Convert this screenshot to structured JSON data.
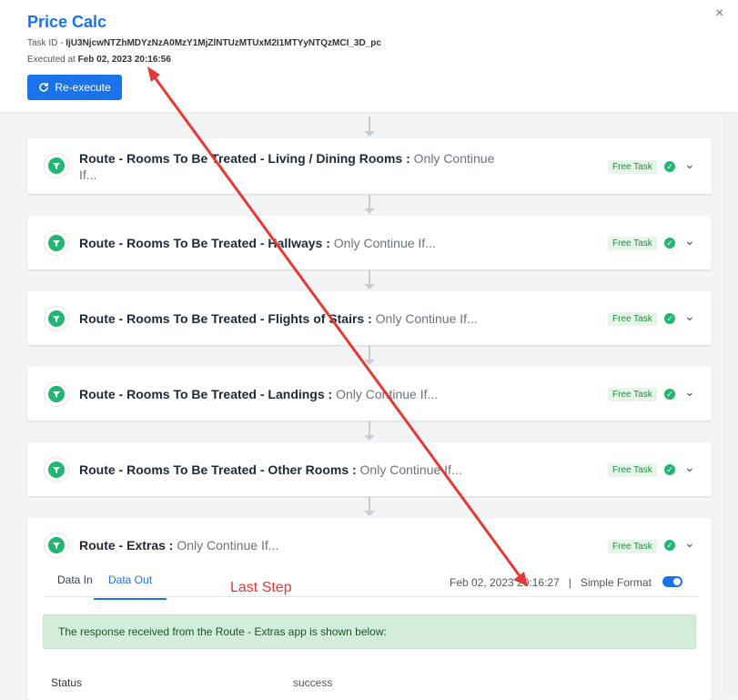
{
  "header": {
    "title": "Price Calc",
    "task_id_label": "Task ID - ",
    "task_id": "IjU3NjcwNTZhMDYzNzA0MzY1MjZlNTUzMTUxM2I1MTYyNTQzMCI_3D_pc",
    "executed_label": "Executed at ",
    "executed_at": "Feb 02, 2023 20:16:56",
    "reexecute_label": "Re-execute",
    "close_glyph": "×"
  },
  "steps": [
    {
      "title": "Route - Rooms To Be Treated - Living / Dining Rooms : ",
      "cond_line1": "Only Continue",
      "cond_line2": "If...",
      "badge": "Free Task"
    },
    {
      "title": "Route - Rooms To Be Treated - Hallways : ",
      "cond": "Only Continue If...",
      "badge": "Free Task"
    },
    {
      "title": "Route - Rooms To Be Treated - Flights of Stairs : ",
      "cond": "Only Continue If...",
      "badge": "Free Task"
    },
    {
      "title": "Route - Rooms To Be Treated - Landings : ",
      "cond": "Only Continue If...",
      "badge": "Free Task"
    },
    {
      "title": "Route - Rooms To Be Treated - Other Rooms : ",
      "cond": "Only Continue If...",
      "badge": "Free Task"
    },
    {
      "title": "Route - Extras : ",
      "cond": "Only Continue If...",
      "badge": "Free Task"
    }
  ],
  "expanded": {
    "tabs": [
      "Data In",
      "Data Out"
    ],
    "active_tab": "Data Out",
    "annotation": "Last Step",
    "timestamp": "Feb 02, 2023 20:16:27   |   Simple Format",
    "notice": "The response received from the Route - Extras app is shown below:",
    "rows": [
      {
        "label": "Status",
        "value": "success"
      }
    ]
  },
  "colors": {
    "accent": "#1a73e8",
    "success": "#22b573",
    "annotation": "#e53935"
  }
}
